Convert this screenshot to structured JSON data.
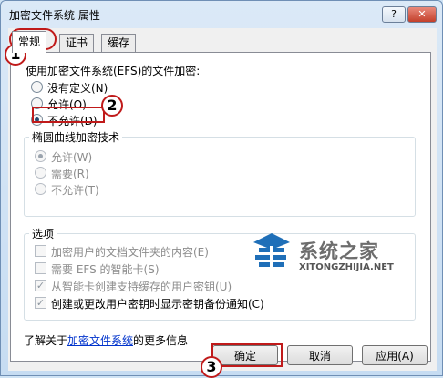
{
  "window": {
    "title": "加密文件系统 属性",
    "help_label": "?",
    "close_label": "✕"
  },
  "tabs": [
    "常规",
    "证书",
    "缓存"
  ],
  "general": {
    "efs_heading": "使用加密文件系统(EFS)的文件加密:",
    "efs_options": [
      "没有定义(N)",
      "允许(O)",
      "不允许(D)"
    ],
    "efs_selected": "不允许(D)",
    "ecc_group_title": "椭圆曲线加密技术",
    "ecc_options": [
      "允许(W)",
      "需要(R)",
      "不允许(T)"
    ],
    "options_group_title": "选项",
    "options": [
      {
        "label": "加密用户的文档文件夹的内容(E)",
        "checked": false
      },
      {
        "label": "需要 EFS 的智能卡(S)",
        "checked": false
      },
      {
        "label": "从智能卡创建支持缓存的用户密钥(U)",
        "checked": true
      },
      {
        "label": "创建或更改用户密钥时显示密钥备份通知(C)",
        "checked": true
      }
    ],
    "learn_more_prefix": "了解关于",
    "learn_more_link": "加密文件系统",
    "learn_more_suffix": "的更多信息"
  },
  "buttons": {
    "ok": "确定",
    "cancel": "取消",
    "apply": "应用(A)"
  },
  "annotations": [
    "1",
    "2",
    "3"
  ],
  "watermark": {
    "title": "系统之家",
    "subtitle": "XITONGZHIJIA.NET"
  }
}
